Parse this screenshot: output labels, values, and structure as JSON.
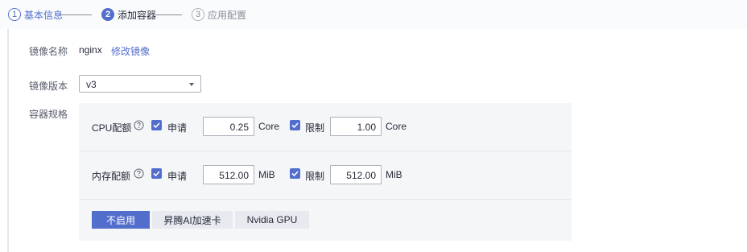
{
  "steps": [
    {
      "num": "1",
      "label": "基本信息"
    },
    {
      "num": "2",
      "label": "添加容器"
    },
    {
      "num": "3",
      "label": "应用配置"
    }
  ],
  "form": {
    "image_name_label": "镜像名称",
    "image_name_value": "nginx",
    "change_image_link": "修改镜像",
    "image_version_label": "镜像版本",
    "image_version_value": "v3",
    "container_spec_label": "容器规格"
  },
  "spec": {
    "cpu": {
      "title": "CPU配额",
      "request_label": "申请",
      "request_value": "0.25",
      "request_unit": "Core",
      "limit_label": "限制",
      "limit_value": "1.00",
      "limit_unit": "Core"
    },
    "memory": {
      "title": "内存配额",
      "request_label": "申请",
      "request_value": "512.00",
      "request_unit": "MiB",
      "limit_label": "限制",
      "limit_value": "512.00",
      "limit_unit": "MiB"
    },
    "accelerator": {
      "options": [
        "不启用",
        "昇腾AI加速卡",
        "Nvidia GPU"
      ],
      "selected": "不启用"
    }
  },
  "colors": {
    "accent": "#526ecc",
    "panel_bg": "#f5f6f8",
    "text": "#252b3a",
    "muted": "#8a8e99"
  },
  "icons": {
    "help": "question-circle-icon",
    "check": "check-icon",
    "dropdown": "caret-down-icon"
  }
}
